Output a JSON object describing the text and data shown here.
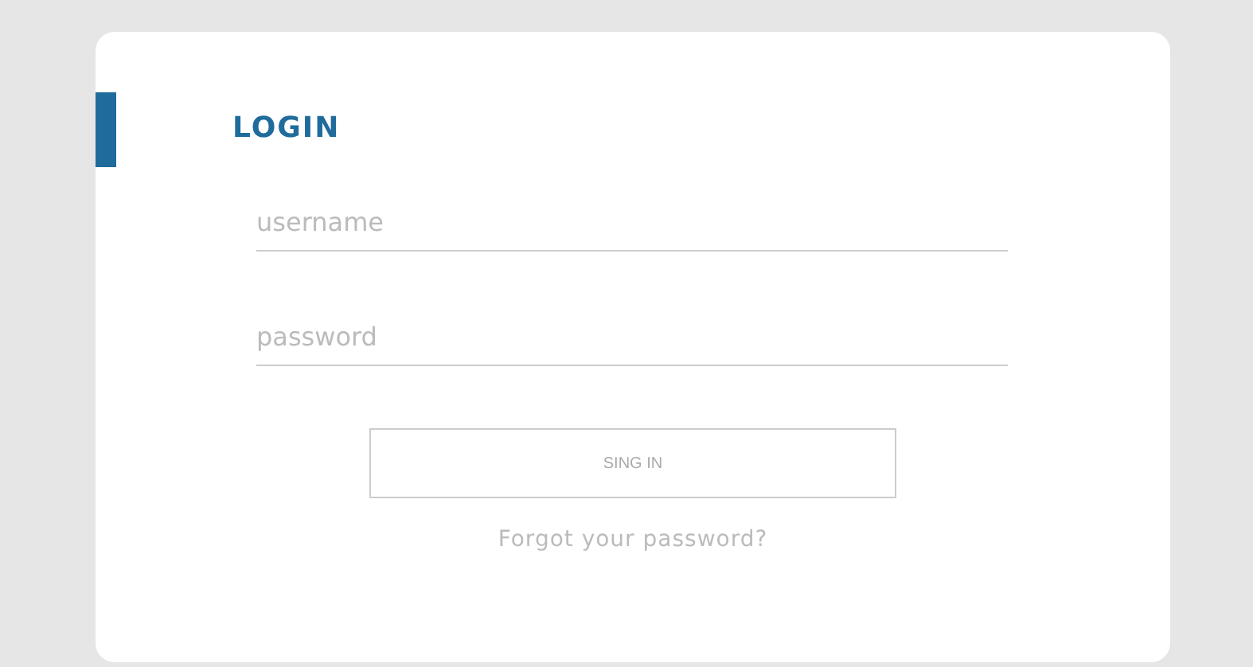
{
  "title": "LOGIN",
  "fields": [
    {
      "placeholder": "username"
    },
    {
      "placeholder": "password"
    }
  ],
  "button": "SING IN",
  "link": "Forgot your password?"
}
